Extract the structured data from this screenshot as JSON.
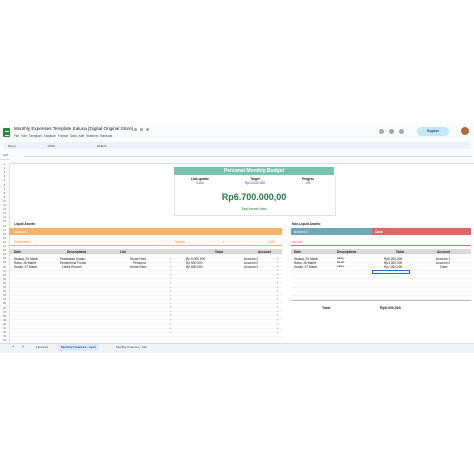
{
  "app": {
    "doc_title": "Monthly Expenses Template Kaluna [Digital Original Store]",
    "menu": [
      "File",
      "Edit",
      "Tampilan",
      "Sisipkan",
      "Format",
      "Data",
      "Alat",
      "Ekstensi",
      "Bantuan"
    ],
    "share_label": "Bagikan",
    "name_box": "A37",
    "toolbar_menus": "Menu",
    "zoom": "100%",
    "font": "Default"
  },
  "sheet": {
    "banner_title": "Personal Monthly Budget",
    "kpi": [
      {
        "label": "Last update",
        "value": "5 Ulo"
      },
      {
        "label": "Target",
        "value": "Rp10.000.000"
      },
      {
        "label": "Progres",
        "value": "0%"
      }
    ],
    "total_value": "Rp6.700.000,00",
    "total_label": "Total Assets Value",
    "liquid_assets_label": "Liquid Assets:",
    "non_liquid_label": "Non-Liquid Assets:",
    "account1_label": "Account 1",
    "account2_label": "Account 2",
    "cash_label": "Cash",
    "expenditure_label": "Expenditure",
    "month_select": "Oktober",
    "year": "2025",
    "income_label": "Income",
    "exp_headers": [
      "Date",
      "Descriptions",
      "List",
      "Value",
      "Account"
    ],
    "exp_rows": [
      [
        "Selasa, 25 Maret",
        "Pelunasan Kosan",
        "Home Rent",
        "Rp 5.000.000",
        "Account 2"
      ],
      [
        "Rabu, 26 Maret",
        "Emoermina Funds",
        "Personal",
        "Rp 500.000",
        "Account 2"
      ],
      [
        "Kamis, 27 Maret",
        "Listrik Rumah",
        "Home Rent",
        "Rp 800.000",
        "Account 2"
      ]
    ],
    "inc_headers": [
      "Date",
      "Descriptions",
      "Value",
      "Account"
    ],
    "inc_rows": [
      [
        "Selasa, 25 Maret",
        "Salary",
        "Rp5.000.000",
        "Account 1"
      ],
      [
        "Rabu, 26 Maret",
        "Bonds",
        "Rp3.000.000",
        "Account 2"
      ],
      [
        "Kamis, 27 Maret",
        "Salary",
        "Rp1.000.000",
        "Cash"
      ]
    ],
    "total_row_label": "Total",
    "total_row_value": "Rp9.000.000"
  },
  "tabs": [
    "Finances",
    "Monthly Finances - April",
    "Monthly Finances - Mei"
  ]
}
